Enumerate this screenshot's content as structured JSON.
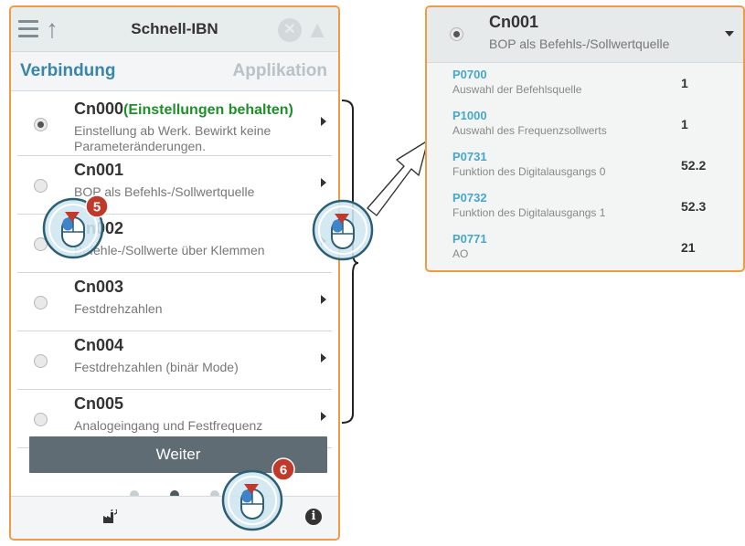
{
  "left_panel": {
    "title": "Schnell-IBN",
    "tabs": {
      "left": "Verbindung",
      "right": "Applikation"
    },
    "items": [
      {
        "code": "Cn000",
        "extra": "(Einstellungen behalten)",
        "desc": "Einstellung ab Werk. Bewirkt keine Parameteränderungen.",
        "selected": true
      },
      {
        "code": "Cn001",
        "extra": "",
        "desc": "BOP als Befehls-/Sollwertquelle",
        "selected": false
      },
      {
        "code": "Cn002",
        "extra": "",
        "desc": "Befehle-/Sollwerte über Klemmen",
        "selected": false
      },
      {
        "code": "Cn003",
        "extra": "",
        "desc": "Festdrehzahlen",
        "selected": false
      },
      {
        "code": "Cn004",
        "extra": "",
        "desc": "Festdrehzahlen (binär Mode)",
        "selected": false
      },
      {
        "code": "Cn005",
        "extra": "",
        "desc": "Analogeingang und Festfrequenz",
        "selected": false
      }
    ],
    "next_button": "Weiter",
    "page_dots": {
      "count": 3,
      "active": 1
    }
  },
  "right_panel": {
    "code": "Cn001",
    "desc": "BOP als Befehls-/Sollwertquelle",
    "params": [
      {
        "code": "P0700",
        "desc": "Auswahl der Befehlsquelle",
        "value": "1"
      },
      {
        "code": "P1000",
        "desc": "Auswahl des Frequenzsollwerts",
        "value": "1"
      },
      {
        "code": "P0731",
        "desc": "Funktion des Digitalausgangs 0",
        "value": "52.2"
      },
      {
        "code": "P0732",
        "desc": "Funktion des Digitalausgangs 1",
        "value": "52.3"
      },
      {
        "code": "P0771",
        "desc": "AO",
        "value": "21"
      }
    ]
  },
  "step_badges": {
    "first": "5",
    "second": "6"
  },
  "colors": {
    "accent": "#f09a45",
    "link": "#3a86a8",
    "highlight_green": "#1f8f2a",
    "badge": "#c0392b"
  }
}
